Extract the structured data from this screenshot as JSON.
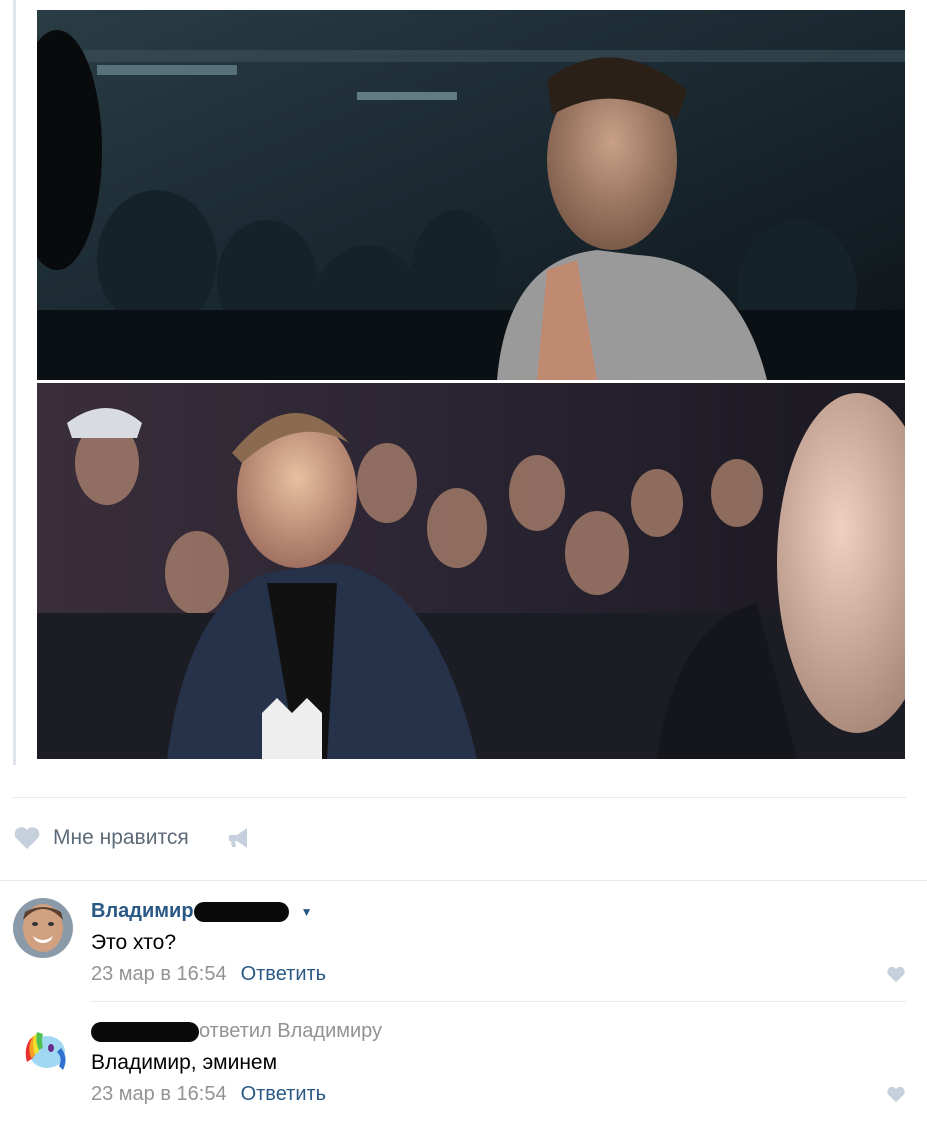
{
  "post": {
    "likes_label": "Мне нравится"
  },
  "comments": [
    {
      "author": "Владимир",
      "text": "Это хто?",
      "date": "23 мар в 16:54",
      "reply_label": "Ответить"
    },
    {
      "reply_to": "ответил Владимиру",
      "text": "Владимир, эминем",
      "date": "23 мар в 16:54",
      "reply_label": "Ответить"
    }
  ],
  "colors": {
    "link": "#2a5885",
    "secondary_text": "#939393",
    "icon": "#c6d0dc",
    "divider": "#e7e8ec"
  }
}
